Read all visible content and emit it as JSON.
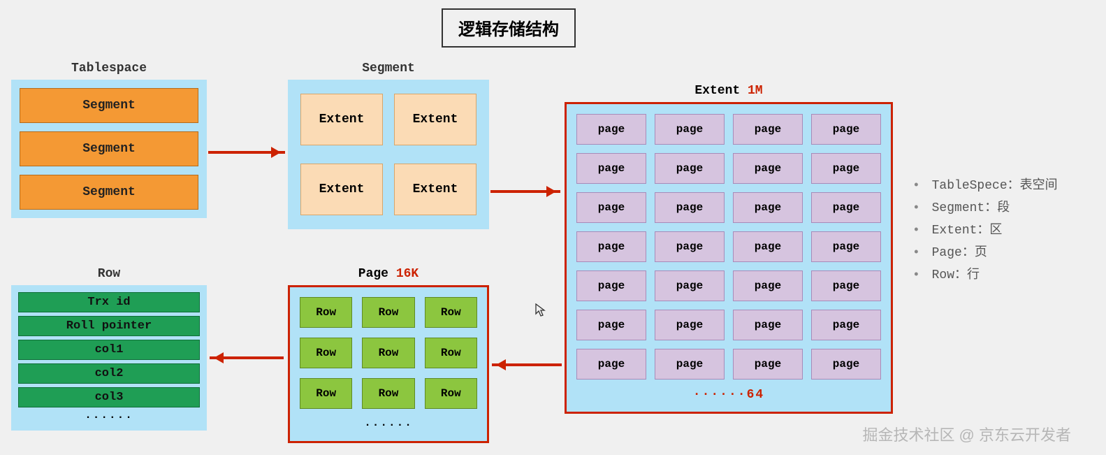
{
  "title": "逻辑存储结构",
  "tablespace": {
    "label": "Tablespace",
    "items": [
      "Segment",
      "Segment",
      "Segment"
    ]
  },
  "segment": {
    "label": "Segment",
    "items": [
      "Extent",
      "Extent",
      "Extent",
      "Extent"
    ]
  },
  "extent": {
    "label": "Extent",
    "size": "1M",
    "page_label": "page",
    "page_count_shown": 28,
    "ellipsis": "······64"
  },
  "page": {
    "label": "Page",
    "size": "16K",
    "row_label": "Row",
    "row_count_shown": 9,
    "ellipsis": "······"
  },
  "row": {
    "label": "Row",
    "fields": [
      "Trx id",
      "Roll pointer",
      "col1",
      "col2",
      "col3"
    ],
    "ellipsis": "······"
  },
  "legend": [
    "TableSpece：表空间",
    "Segment：段",
    "Extent：区",
    "Page：页",
    "Row：行"
  ],
  "watermark": "掘金技术社区 @ 京东云开发者"
}
